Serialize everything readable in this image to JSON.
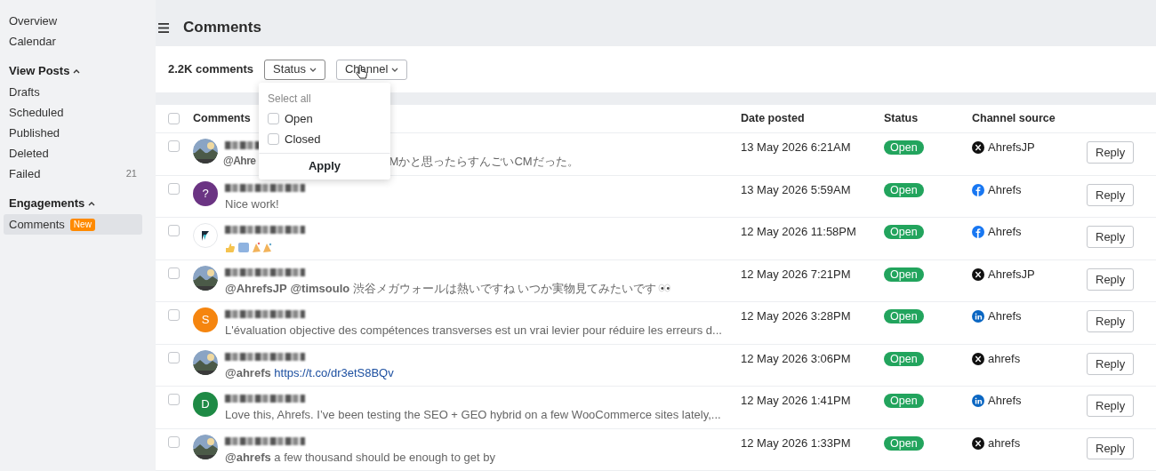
{
  "sidebar": {
    "items": [
      {
        "label": "Overview",
        "selected": false
      },
      {
        "label": "Calendar",
        "selected": false
      }
    ],
    "sections": [
      {
        "title": "View Posts",
        "expanded": true,
        "items": [
          {
            "label": "Drafts",
            "selected": false
          },
          {
            "label": "Scheduled",
            "selected": false
          },
          {
            "label": "Published",
            "selected": false
          },
          {
            "label": "Deleted",
            "selected": false
          },
          {
            "label": "Failed",
            "count": "21",
            "selected": false
          }
        ]
      },
      {
        "title": "Engagements",
        "expanded": true,
        "items": [
          {
            "label": "Comments",
            "badge": "New",
            "selected": true
          }
        ]
      }
    ]
  },
  "page": {
    "title": "Comments"
  },
  "toolbar": {
    "count": "2.2K comments",
    "filters": [
      {
        "label": "Status",
        "open": true
      },
      {
        "label": "Channel",
        "open": false
      }
    ]
  },
  "dropdown": {
    "select_all": "Select all",
    "options": [
      {
        "label": "Open",
        "checked": false
      },
      {
        "label": "Closed",
        "checked": false
      }
    ],
    "apply": "Apply"
  },
  "table": {
    "header_checked": false,
    "columns": [
      "Comments",
      "Date posted",
      "Status",
      "Channel source"
    ],
    "rows": [
      {
        "comment_parts": [
          "**@Ahre**",
          "Mかと思ったらすんごいCMだった。"
        ],
        "date": "13 May 2026 6:21AM",
        "status": "Open",
        "channel": {
          "kind": "x",
          "account": "AhrefsJP"
        },
        "action": "Reply",
        "checked": false
      },
      {
        "avatar": {
          "kind": "letter",
          "letter": "?",
          "color": "#6b3483"
        },
        "comment": "Nice work!",
        "date": "13 May 2026 5:59AM",
        "status": "Open",
        "channel": {
          "kind": "facebook",
          "account": "Ahrefs"
        },
        "action": "Reply",
        "checked": false
      },
      {
        "avatar": {
          "kind": "logo"
        },
        "emoji": true,
        "date": "12 May 2026 11:58PM",
        "status": "Open",
        "channel": {
          "kind": "facebook",
          "account": "Ahrefs"
        },
        "action": "Reply",
        "checked": false
      },
      {
        "comment": "**@AhrefsJP** **@timsoulo** 渋谷メガウォールは熱いですね いつか実物見てみたいです",
        "eyes": true,
        "date": "12 May 2026 7:21PM",
        "status": "Open",
        "channel": {
          "kind": "x",
          "account": "AhrefsJP"
        },
        "action": "Reply",
        "checked": false
      },
      {
        "avatar": {
          "kind": "letter",
          "letter": "S",
          "color": "#f5850f"
        },
        "comment": "L'évaluation objective des compétences transverses est un vrai levier pour réduire les erreurs d...",
        "date": "12 May 2026 3:28PM",
        "status": "Open",
        "channel": {
          "kind": "linkedin",
          "account": "Ahrefs"
        },
        "action": "Reply",
        "checked": false
      },
      {
        "comment": "**@ahrefs**",
        "link": "https://t.co/dr3etS8BQv",
        "date": "12 May 2026 3:06PM",
        "status": "Open",
        "channel": {
          "kind": "x",
          "account": "ahrefs"
        },
        "action": "Reply",
        "checked": false
      },
      {
        "avatar": {
          "kind": "letter",
          "letter": "D",
          "color": "#1e8a45"
        },
        "comment": "Love this, Ahrefs. I’ve been testing the SEO + GEO hybrid on a few WooCommerce sites lately,...",
        "date": "12 May 2026 1:41PM",
        "status": "Open",
        "channel": {
          "kind": "linkedin",
          "account": "Ahrefs"
        },
        "action": "Reply",
        "checked": false
      },
      {
        "comment": "**@ahrefs** a few thousand should be enough to get by",
        "date": "12 May 2026 1:33PM",
        "status": "Open",
        "channel": {
          "kind": "x",
          "account": "ahrefs"
        },
        "action": "Reply",
        "checked": false
      }
    ]
  }
}
